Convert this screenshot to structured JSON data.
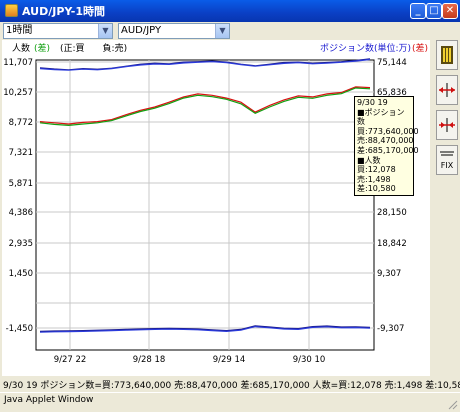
{
  "window": {
    "title": "AUD/JPY-1時間",
    "min_label": "_",
    "max_label": "□",
    "close_label": "✕"
  },
  "toolbar": {
    "interval": "1時間",
    "symbol": "AUD/JPY"
  },
  "chart_header": {
    "left_label": "人数",
    "left_sign": "(差)",
    "left_legend": "(正:買　　負:売)",
    "right_label": "ポジション数(単位:万)",
    "right_sign": "(差)"
  },
  "chart_data": {
    "type": "line",
    "left_axis_ticks": [
      "11,707",
      "10,257",
      "8,772",
      "7,321",
      "5,871",
      "4,386",
      "2,935",
      "1,450",
      "",
      "-1,450"
    ],
    "right_axis_ticks": [
      "75,144",
      "65,836",
      "",
      "",
      "",
      "28,150",
      "18,842",
      "9,307",
      "",
      "-9,307"
    ],
    "x_ticks": [
      "9/27 22",
      "9/28 18",
      "9/29 14",
      "9/30 10"
    ],
    "series": [
      {
        "name": "",
        "color": "#1a1a8c",
        "values": [
          11420,
          11360,
          11320,
          11380,
          11350,
          11400,
          11500,
          11600,
          11650,
          11620,
          11700,
          11720,
          11750,
          11700,
          11600,
          11520,
          11600,
          11680,
          11700,
          11650,
          11680,
          11720,
          11780,
          11860
        ]
      },
      {
        "name": "",
        "color": "#2b3bdc",
        "values": [
          11380,
          11330,
          11300,
          11350,
          11320,
          11380,
          11480,
          11560,
          11610,
          11590,
          11660,
          11690,
          11720,
          11670,
          11580,
          11500,
          11570,
          11640,
          11670,
          11620,
          11650,
          11690,
          11750,
          11830
        ]
      },
      {
        "name": "",
        "color": "#d81010",
        "values": [
          8760,
          8700,
          8640,
          8720,
          8760,
          8860,
          9100,
          9320,
          9480,
          9720,
          9980,
          10130,
          10060,
          9920,
          9720,
          9230,
          9560,
          9830,
          10030,
          9980,
          10130,
          10200,
          10480,
          10440
        ]
      },
      {
        "name": "",
        "color": "#11a011",
        "values": [
          8700,
          8620,
          8570,
          8640,
          8700,
          8810,
          9040,
          9260,
          9420,
          9650,
          9920,
          10060,
          9990,
          9860,
          9640,
          9170,
          9480,
          9760,
          9960,
          9910,
          10060,
          10140,
          10420,
          10380
        ]
      },
      {
        "name": "",
        "color": "#1a1a8c",
        "values": [
          -1620,
          -1600,
          -1590,
          -1580,
          -1560,
          -1540,
          -1520,
          -1500,
          -1480,
          -1470,
          -1480,
          -1500,
          -1540,
          -1580,
          -1520,
          -1340,
          -1400,
          -1460,
          -1480,
          -1380,
          -1350,
          -1400,
          -1390,
          -1420
        ]
      },
      {
        "name": "",
        "color": "#2b3bdc",
        "values": [
          -1660,
          -1640,
          -1630,
          -1620,
          -1600,
          -1580,
          -1560,
          -1540,
          -1520,
          -1510,
          -1520,
          -1540,
          -1580,
          -1620,
          -1560,
          -1380,
          -1440,
          -1500,
          -1520,
          -1420,
          -1390,
          -1440,
          -1430,
          -1460
        ]
      }
    ],
    "ylim": [
      -1900,
      12100
    ],
    "grid": true
  },
  "tooltip": {
    "lines": [
      "9/30 19",
      "■ポジション数",
      "買:773,640,000",
      "売:88,470,000",
      "差:685,170,000",
      "■人数",
      "買:12,078",
      "売:1,498",
      "差:10,580"
    ]
  },
  "side_buttons": [
    {
      "icon": "chart-toggle-icon"
    },
    {
      "icon": "zoom-out-horizontal-icon"
    },
    {
      "icon": "zoom-in-horizontal-icon"
    },
    {
      "icon": "fix-icon",
      "label": "FIX"
    }
  ],
  "status_bar": {
    "text": "9/30 19 ポジション数=買:773,640,000 売:88,470,000 差:685,170,000 人数=買:12,078 売:1,498 差:10,580"
  },
  "java_bar": {
    "text": "Java Applet Window"
  }
}
